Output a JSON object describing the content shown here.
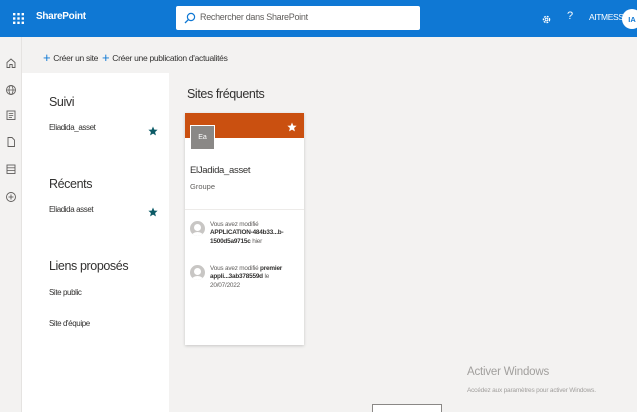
{
  "header": {
    "app_name": "SharePoint",
    "search_placeholder": "Rechercher dans SharePoint",
    "help": "?",
    "user_name": "AITMESSAOUD M...",
    "avatar_initials": "IA",
    "bar_color": "#0f78d4"
  },
  "commands": {
    "create_site": "Créer un site",
    "create_news": "Créer une publication d'actualités"
  },
  "left_panel": {
    "followed_title": "Suivi",
    "followed_items": [
      "Eliadida_asset"
    ],
    "recent_title": "Récents",
    "recent_items": [
      "Eliadida asset"
    ],
    "links_title": "Liens proposés",
    "links": [
      "Site public",
      "Site d'équipe"
    ]
  },
  "main": {
    "frequent_title": "Sites fréquents",
    "card": {
      "logo_text": "Ea",
      "site_name": "ElJadida_asset",
      "site_type": "Groupe",
      "band_color": "#ca5010",
      "activities": [
        {
          "prefix": "Vous avez modifié",
          "item": "APPLICATION-484b33...b-1500d5a9715c",
          "suffix": "hier"
        },
        {
          "prefix": "Vous avez modifié",
          "item": "premier appli...3ab378559d",
          "suffix": "le",
          "date": "20/07/2022"
        }
      ]
    }
  },
  "watermark": {
    "title": "Activer Windows",
    "subtitle": "Accédez aux paramètres pour activer Windows."
  },
  "icons": [
    "waffle-icon",
    "search-icon",
    "gear-icon",
    "home-icon",
    "globe-icon",
    "news-icon",
    "files-icon",
    "lists-icon",
    "add-icon",
    "star-icon"
  ]
}
